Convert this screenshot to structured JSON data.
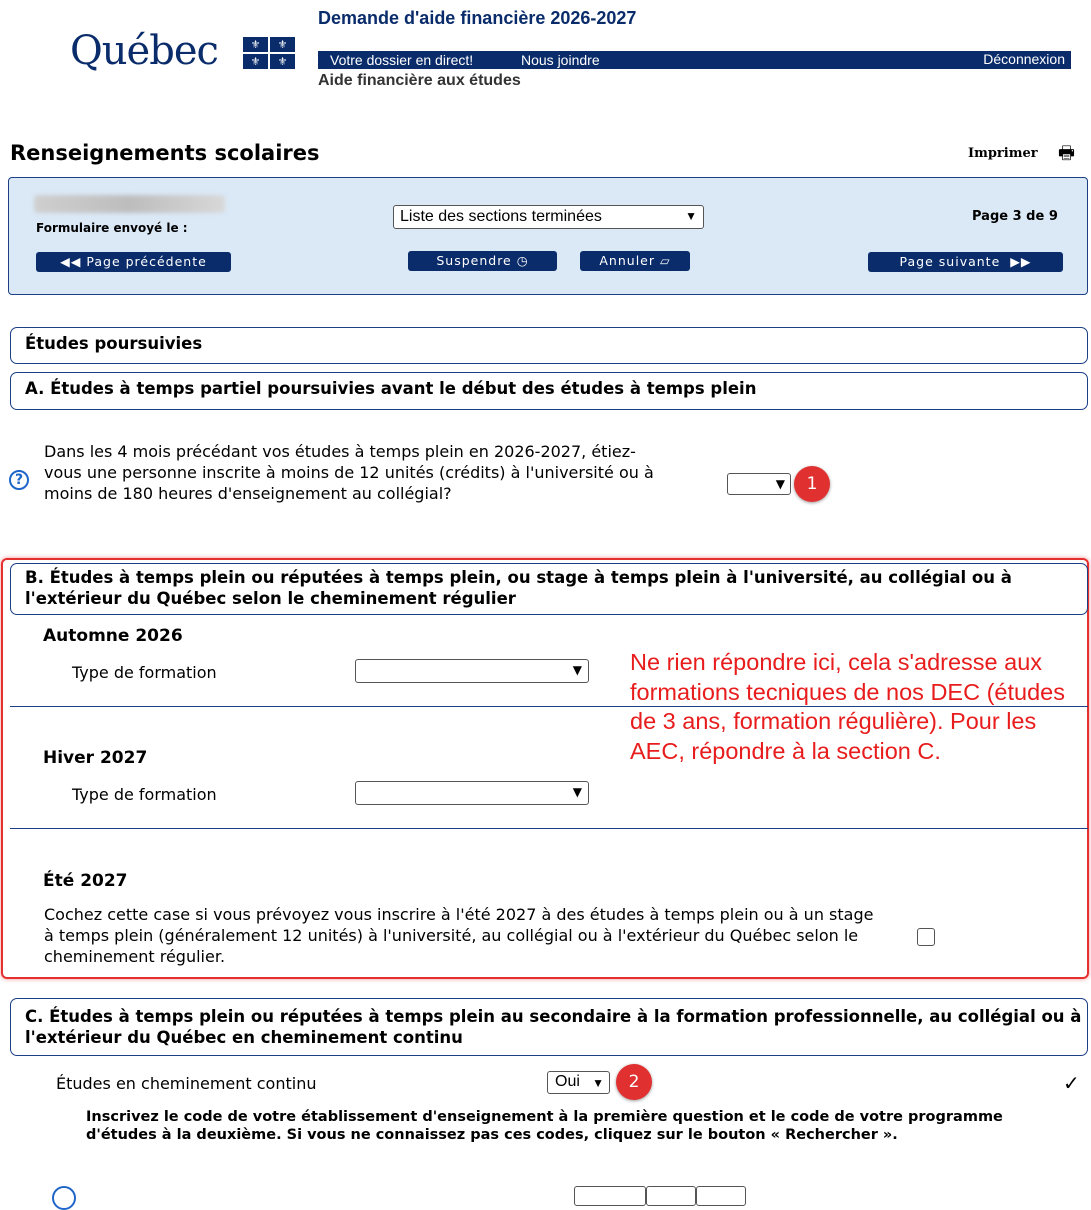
{
  "header": {
    "logo_text": "Québec",
    "app_title": "Demande d'aide financière 2026-2027",
    "nav": {
      "dossier": "Votre dossier en direct!",
      "contact": "Nous joindre",
      "logout": "Déconnexion"
    },
    "subtitle": "Aide financière aux études"
  },
  "page": {
    "title": "Renseignements scolaires",
    "print_label": "Imprimer",
    "print_icon": "printer-icon"
  },
  "formbar": {
    "sent_label": "Formulaire envoyé le :",
    "sections_select": "Liste des sections terminées",
    "page_indicator": "Page 3 de 9",
    "prev_button": "Page précédente",
    "suspend_button": "Suspendre",
    "cancel_button": "Annuler",
    "next_button": "Page suivante"
  },
  "sections": {
    "main": "Études poursuivies",
    "a_title": "A. Études à temps partiel poursuivies avant le début des études à temps plein",
    "a_question": "Dans les 4 mois précédant vos études à temps plein en 2026-2027, étiez-vous une personne inscrite à moins de 12 unités (crédits) à l'université ou à moins de 180 heures d'enseignement au collégial?",
    "a_answer": "",
    "b_title": "B. Études à temps plein ou réputées à temps plein, ou stage à temps plein à l'université, au collégial ou à l'extérieur du Québec selon le cheminement régulier",
    "b_autumn": "Automne 2026",
    "b_winter": "Hiver 2027",
    "b_summer": "Été 2027",
    "type_label": "Type de formation",
    "b_summer_text": "Cochez cette case si vous prévoyez vous inscrire à l'été 2027 à des études à temps plein ou à un stage à temps plein (généralement 12 unités) à l'université, au collégial ou à l'extérieur du Québec selon le cheminement régulier.",
    "c_title": "C. Études à temps plein ou réputées à temps plein au secondaire à la formation professionnelle, au collégial ou à l'extérieur du Québec en cheminement continu",
    "c_label": "Études en cheminement continu",
    "c_answer": "Oui",
    "c_note": "Inscrivez le code de votre établissement d'enseignement à la première question et le code de votre programme d'études à la deuxième. Si vous ne connaissez pas ces codes, cliquez sur le bouton « Rechercher »."
  },
  "annotations": {
    "badge1": "1",
    "badge2": "2",
    "note": "Ne rien répondre ici, cela s'adresse aux formations tecniques de nos DEC (études de 3 ans, formation régulière). Pour les AEC, répondre à la section C.",
    "check": "✓",
    "colors": {
      "annotation_red": "#e81c1c",
      "brand_blue": "#0a2c6b",
      "panel_blue": "#dbe9f7"
    }
  }
}
